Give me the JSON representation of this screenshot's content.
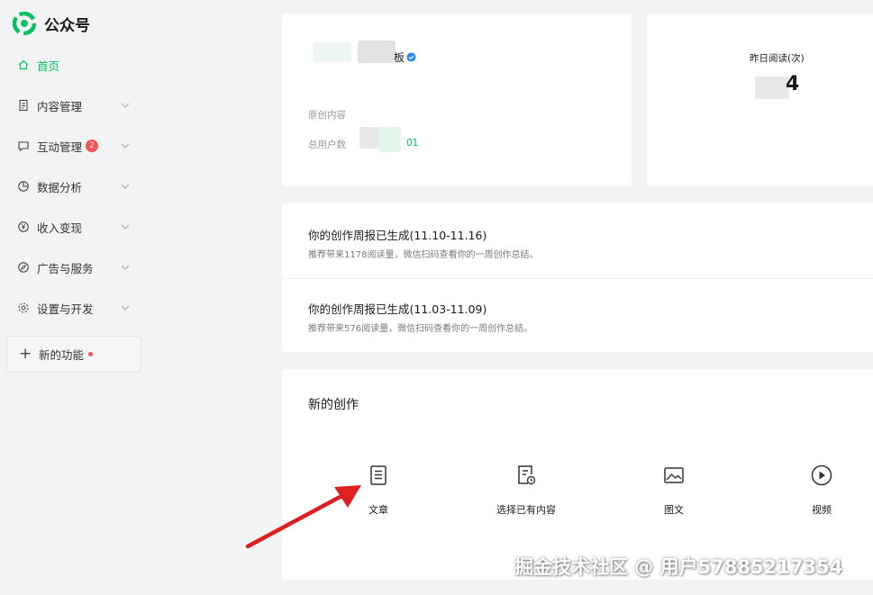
{
  "brand": {
    "name": "公众号",
    "logo_icon": "wechat-official-logo",
    "color": "#07c160"
  },
  "sidebar": {
    "items": [
      {
        "label": "首页",
        "icon": "home-icon",
        "active": true
      },
      {
        "label": "内容管理",
        "icon": "document-icon"
      },
      {
        "label": "互动管理",
        "icon": "chat-icon",
        "badge": "2"
      },
      {
        "label": "数据分析",
        "icon": "pie-chart-icon"
      },
      {
        "label": "收入变现",
        "icon": "yen-icon"
      },
      {
        "label": "广告与服务",
        "icon": "compass-icon"
      },
      {
        "label": "设置与开发",
        "icon": "gear-icon"
      }
    ],
    "new_feature": {
      "label": "新的功能"
    }
  },
  "profile": {
    "account_name_suffix": "板",
    "original_label": "原创内容",
    "users_label": "总用户数",
    "users_value_visible": "01"
  },
  "stats": {
    "yesterday_reads_label": "昨日阅读(次)",
    "yesterday_reads_value_visible": "4"
  },
  "reports": [
    {
      "title": "你的创作周报已生成(11.10-11.16)",
      "desc": "推荐带来1178阅读量，微信扫码查看你的一周创作总结。"
    },
    {
      "title": "你的创作周报已生成(11.03-11.09)",
      "desc": "推荐带来576阅读量，微信扫码查看你的一周创作总结。"
    }
  ],
  "create": {
    "title": "新的创作",
    "buttons": [
      {
        "label": "文章",
        "icon": "article-icon"
      },
      {
        "label": "选择已有内容",
        "icon": "existing-content-icon"
      },
      {
        "label": "图文",
        "icon": "image-text-icon"
      },
      {
        "label": "视频",
        "icon": "video-play-icon"
      }
    ]
  },
  "annotation": {
    "arrow_color": "#e02020"
  },
  "watermark": "掘金技术社区 @ 用户57885217354"
}
